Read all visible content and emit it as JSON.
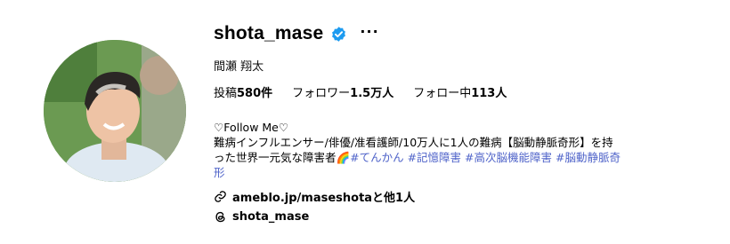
{
  "profile": {
    "username": "shota_mase",
    "full_name": "間瀬 翔太",
    "more_label": "···",
    "verified_icon": "verified-badge-icon",
    "verified_color": "#1d9bf0"
  },
  "stats": {
    "posts_label": "投稿",
    "posts_value": "580件",
    "followers_label": "フォロワー",
    "followers_value": "1.5万人",
    "following_label": "フォロー中",
    "following_value": "113人"
  },
  "bio": {
    "line1": "♡Follow Me♡",
    "line2": "難病インフルエンサー/俳優/准看護師/10万人に1人の難病【脳動静脈奇形】を持",
    "line3_text": "った世界一元気な障害者",
    "line3_emoji": "🌈",
    "hashtags": [
      "#てんかん",
      "#記憶障害",
      "#高次脳機能障害",
      "#脳動静脈奇"
    ],
    "line4": "形",
    "hashtag_color": "#4f63c9"
  },
  "links": {
    "website_icon": "link-icon",
    "website_text": "ameblo.jp/maseshotaと他1人",
    "threads_icon": "threads-icon",
    "threads_text": "shota_mase"
  }
}
